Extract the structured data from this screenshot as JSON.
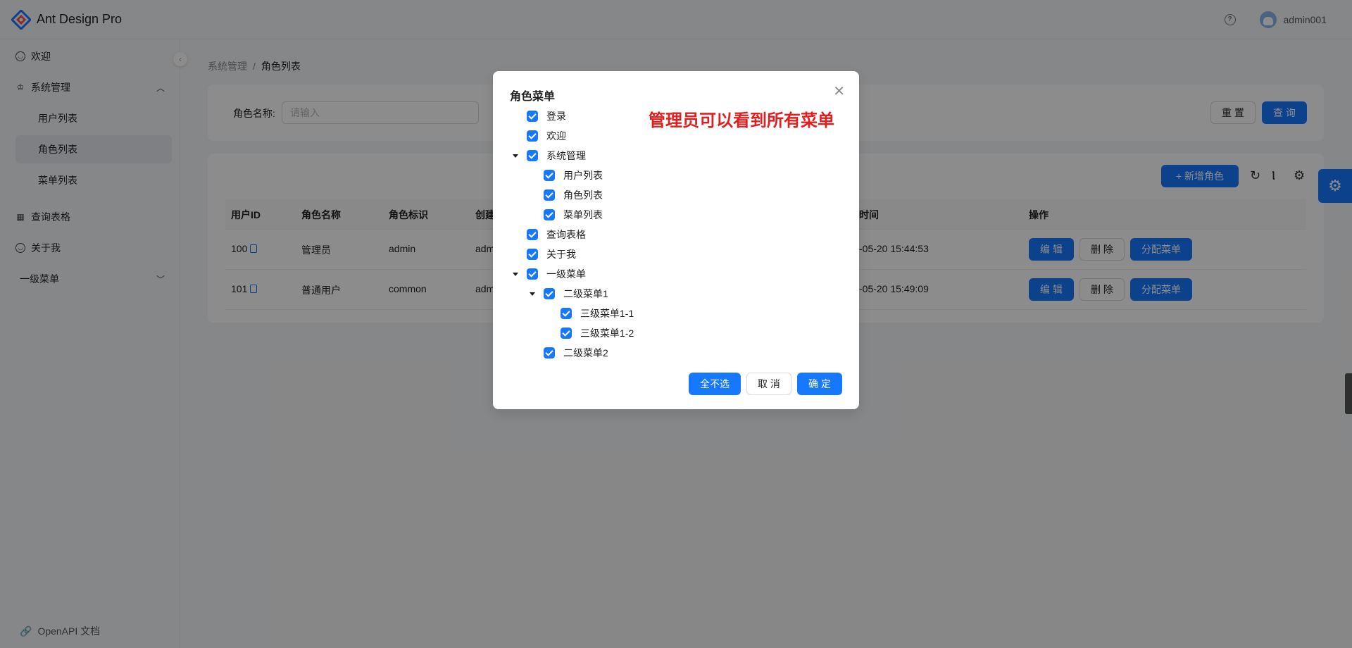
{
  "header": {
    "app_title": "Ant Design Pro",
    "username": "admin001"
  },
  "sidebar": {
    "items": [
      {
        "label": "欢迎",
        "icon": "smile-icon"
      },
      {
        "label": "系统管理",
        "icon": "crown-icon",
        "expanded": true
      },
      {
        "label": "查询表格",
        "icon": "table-icon"
      },
      {
        "label": "关于我",
        "icon": "smile-icon"
      },
      {
        "label": "一级菜单",
        "icon": "",
        "expanded": false
      }
    ],
    "sub_items": [
      {
        "label": "用户列表"
      },
      {
        "label": "角色列表",
        "active": true
      },
      {
        "label": "菜单列表"
      }
    ],
    "footer_link": "OpenAPI 文档"
  },
  "breadcrumb": {
    "parent": "系统管理",
    "separator": "/",
    "current": "角色列表"
  },
  "search": {
    "label": "角色名称:",
    "placeholder": "请输入",
    "reset_label": "重 置",
    "query_label": "查 询"
  },
  "table": {
    "add_label": "+ 新增角色",
    "columns": [
      "用户ID",
      "角色名称",
      "角色标识",
      "创建",
      "时间",
      "操作"
    ],
    "rows": [
      {
        "id": "100",
        "name": "管理员",
        "key": "admin",
        "creator": "adm",
        "time": "-05-20 15:44:53"
      },
      {
        "id": "101",
        "name": "普通用户",
        "key": "common",
        "creator": "adm",
        "time": "-05-20 15:49:09"
      }
    ],
    "actions": {
      "edit": "编 辑",
      "delete": "删 除",
      "assign": "分配菜单"
    }
  },
  "modal": {
    "title": "角色菜单",
    "annotation": "管理员可以看到所有菜单",
    "tree": [
      {
        "label": "登录",
        "level": 0,
        "checked": true,
        "expandable": false
      },
      {
        "label": "欢迎",
        "level": 0,
        "checked": true,
        "expandable": false
      },
      {
        "label": "系统管理",
        "level": 0,
        "checked": true,
        "expandable": true
      },
      {
        "label": "用户列表",
        "level": 1,
        "checked": true,
        "expandable": false
      },
      {
        "label": "角色列表",
        "level": 1,
        "checked": true,
        "expandable": false
      },
      {
        "label": "菜单列表",
        "level": 1,
        "checked": true,
        "expandable": false
      },
      {
        "label": "查询表格",
        "level": 0,
        "checked": true,
        "expandable": false
      },
      {
        "label": "关于我",
        "level": 0,
        "checked": true,
        "expandable": false
      },
      {
        "label": "一级菜单",
        "level": 0,
        "checked": true,
        "expandable": true
      },
      {
        "label": "二级菜单1",
        "level": 1,
        "checked": true,
        "expandable": true
      },
      {
        "label": "三级菜单1-1",
        "level": 2,
        "checked": true,
        "expandable": false
      },
      {
        "label": "三级菜单1-2",
        "level": 2,
        "checked": true,
        "expandable": false
      },
      {
        "label": "二级菜单2",
        "level": 1,
        "checked": true,
        "expandable": false
      }
    ],
    "buttons": {
      "deselect_all": "全不选",
      "cancel": "取 消",
      "ok": "确 定"
    }
  },
  "colors": {
    "primary": "#1677ff",
    "annotation": "#e21e1e"
  }
}
